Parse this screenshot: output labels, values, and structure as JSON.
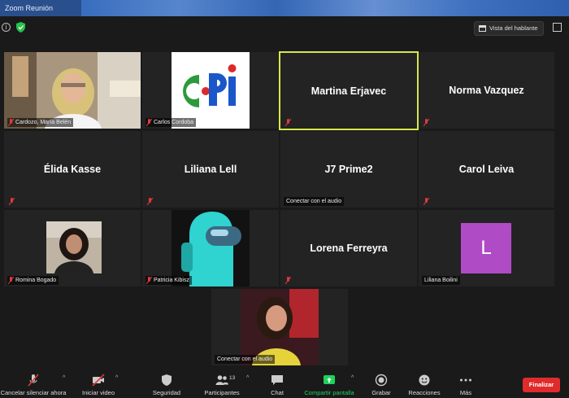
{
  "window": {
    "title": "Zoom Reunión"
  },
  "topbar": {
    "view_button": "Vista del hablante"
  },
  "tiles": {
    "t1": {
      "label": "Cardozo, María Belén"
    },
    "t2": {
      "label": "Carlos Cordoba"
    },
    "t3": {
      "name": "Martina Erjavec"
    },
    "t4": {
      "name": "Norma Vazquez"
    },
    "t5": {
      "name": "Élida Kasse"
    },
    "t6": {
      "name": "Liliana Lell"
    },
    "t7": {
      "name": "J7 Prime2",
      "label": "Conectar con el audio"
    },
    "t8": {
      "name": "Carol Leiva"
    },
    "t9": {
      "label": "Romina Bogado"
    },
    "t10": {
      "label": "Patricia Kibisz"
    },
    "t11": {
      "name": "Lorena Ferreyra"
    },
    "t12": {
      "label": "Liliana Boilini",
      "initial": "L",
      "avatar_color": "#b04bc6"
    },
    "t13": {
      "label": "Conectar con el audio"
    }
  },
  "toolbar": {
    "mute": "Cancelar silenciar ahora",
    "video": "Iniciar video",
    "security": "Seguridad",
    "participants": "Participantes",
    "participants_count": "13",
    "chat": "Chat",
    "share": "Compartir pantalla",
    "record": "Grabar",
    "reactions": "Reacciones",
    "more": "Más",
    "end": "Finalizar"
  },
  "colors": {
    "active_speaker": "#d7e84c",
    "share_green": "#1ed35b",
    "end_red": "#e02b2b",
    "mute_red": "#e03a3a"
  }
}
